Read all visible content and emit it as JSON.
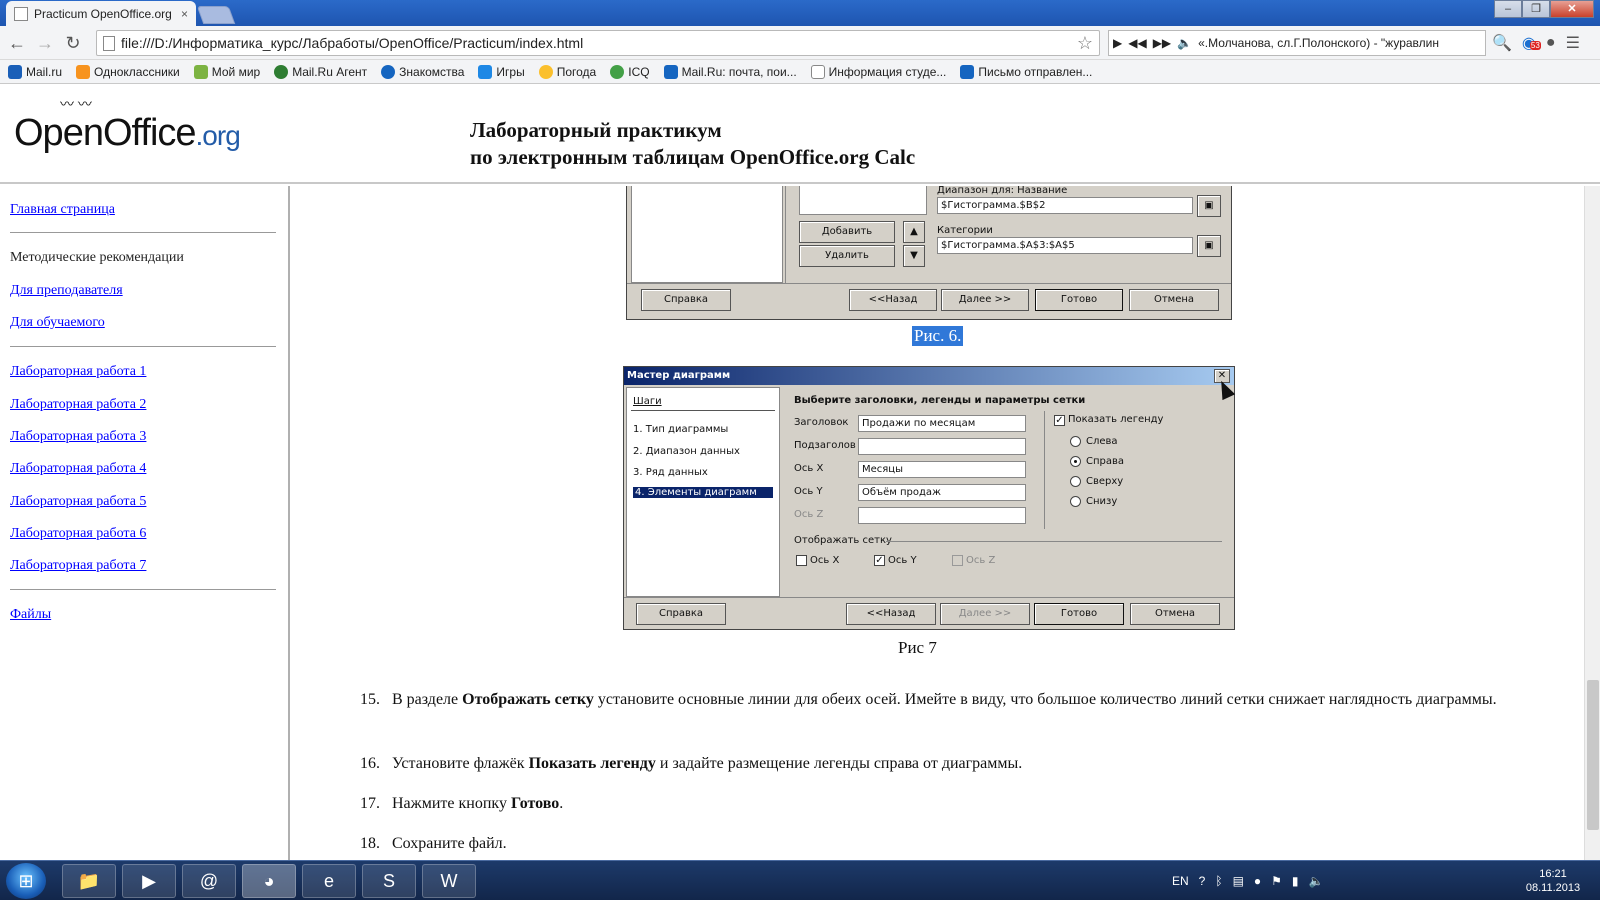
{
  "browser": {
    "tab_title": "Practicum OpenOffice.org",
    "tab_close": "×",
    "url": "file:///D:/Информатика_курс/Лабработы/OpenOffice/Practicum/index.html",
    "media_text": "«.Молчанова, сл.Г.Полонского) - \"журавлин",
    "badge_count": "53",
    "bookmarks": [
      "Mail.ru",
      "Одноклассники",
      "Мой мир",
      "Mail.Ru Агент",
      "Знакомства",
      "Игры",
      "Погода",
      "ICQ",
      "Mail.Ru: почта, пои...",
      "Информация студе...",
      "Письмо отправлен..."
    ]
  },
  "header": {
    "logo_main": "OpenOffice",
    "logo_suffix": ".org",
    "title_line1": "Лабораторный практикум",
    "title_line2": "по электронным таблицам OpenOffice.org Calc"
  },
  "sidebar": {
    "home": "Главная страница",
    "methodics": "Методические рекомендации",
    "for_teacher": "Для преподавателя",
    "for_student": "Для обучаемого",
    "labs": [
      "Лабораторная работа 1",
      "Лабораторная работа 2",
      "Лабораторная работа 3",
      "Лабораторная работа 4",
      "Лабораторная работа 5",
      "Лабораторная работа 6",
      "Лабораторная работа 7"
    ],
    "files": "Файлы"
  },
  "fig6": {
    "range_label": "Диапазон для: Название",
    "range_value": "$Гистограмма.$B$2",
    "categories_label": "Категории",
    "categories_value": "$Гистограмма.$A$3:$A$5",
    "add": "Добавить",
    "remove": "Удалить",
    "help": "Справка",
    "back": "<<Назад",
    "next": "Далее >>",
    "done": "Готово",
    "cancel": "Отмена",
    "caption": "Рис. 6."
  },
  "fig7": {
    "title": "Мастер диаграмм",
    "steps_header": "Шаги",
    "steps": [
      "1.  Тип диаграммы",
      "2.  Диапазон данных",
      "3.  Ряд данных",
      "4.  Элементы диаграмм"
    ],
    "section_title": "Выберите заголовки, легенды и параметры сетки",
    "title_label": "Заголовок",
    "title_value": "Продажи по месяцам",
    "subtitle_label": "Подзаголов",
    "subtitle_value": "",
    "x_label": "Ось X",
    "x_value": "Месяцы",
    "y_label": "Ось Y",
    "y_value": "Объём продаж",
    "z_label": "Ось Z",
    "z_value": "",
    "show_legend": "Показать легенду",
    "legend_left": "Слева",
    "legend_right": "Справа",
    "legend_top": "Сверху",
    "legend_bottom": "Снизу",
    "grid_label": "Отображать сетку",
    "grid_x": "Ось X",
    "grid_y": "Ось Y",
    "grid_z": "Ось Z",
    "help": "Справка",
    "back": "<<Назад",
    "next": "Далее >>",
    "done": "Готово",
    "cancel": "Отмена",
    "caption": "Рис 7"
  },
  "steps": [
    {
      "num": "15.",
      "pre": "В разделе ",
      "bold": "Отображать сетку",
      "post": " установите основные линии для обеих осей. Имейте в виду, что большое количество линий сетки снижает наглядность диаграммы."
    },
    {
      "num": "16.",
      "pre": "Установите флажёк ",
      "bold": "Показать легенду",
      "post": " и задайте размещение легенды справа от диаграммы."
    },
    {
      "num": "17.",
      "pre": "Нажмите кнопку ",
      "bold": "Готово",
      "post": "."
    },
    {
      "num": "18.",
      "pre": "Сохраните файл.",
      "bold": "",
      "post": ""
    }
  ],
  "taskbar": {
    "lang": "EN",
    "time": "16:21",
    "date": "08.11.2013"
  }
}
